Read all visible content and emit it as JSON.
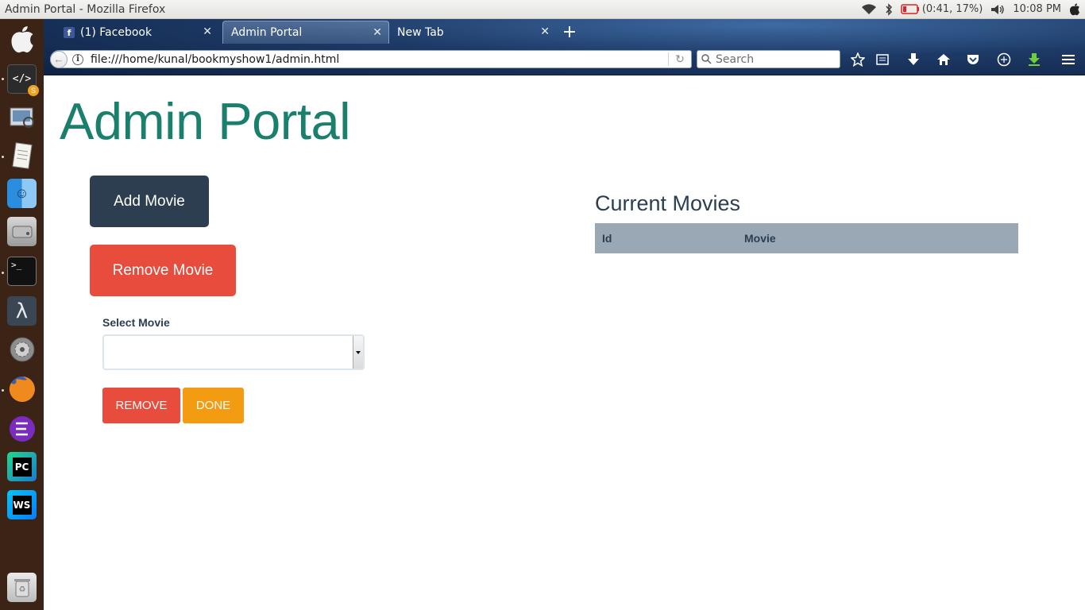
{
  "os": {
    "window_title": "Admin Portal - Mozilla Firefox",
    "battery_text": "(0:41, 17%)",
    "clock": "10:08 PM",
    "icons": [
      "wifi-icon",
      "bluetooth-icon",
      "battery-icon",
      "volume-icon",
      "apple-menu-icon"
    ]
  },
  "launcher": {
    "items": [
      "apple-logo-icon",
      "code-editor-icon",
      "image-viewer-icon",
      "text-editor-icon",
      "finder-icon",
      "disk-icon",
      "terminal-icon",
      "lambda-icon",
      "settings-icon",
      "firefox-icon",
      "emacs-icon",
      "pycharm-icon",
      "webstorm-icon",
      "trash-icon"
    ]
  },
  "browser": {
    "tabs": [
      {
        "label": "(1) Facebook",
        "favicon": "f"
      },
      {
        "label": "Admin Portal"
      },
      {
        "label": "New Tab"
      }
    ],
    "new_tab_label": "+",
    "url": "file:///home/kunal/bookmyshow1/admin.html",
    "search_placeholder": "Search"
  },
  "page": {
    "title": "Admin Portal",
    "add_movie_label": "Add Movie",
    "remove_movie_label": "Remove Movie",
    "select_label": "Select Movie",
    "select_value": "",
    "remove_label": "REMOVE",
    "done_label": "DONE",
    "current_movies_title": "Current Movies",
    "table_headers": [
      "Id",
      "Movie"
    ]
  },
  "colors": {
    "title": "#1a7f6b",
    "add_button": "#2c3e50",
    "remove_button": "#e74c3c",
    "done_button": "#f39c12",
    "table_header": "#9aa8b6",
    "launcher_bg": "#3b2415"
  }
}
